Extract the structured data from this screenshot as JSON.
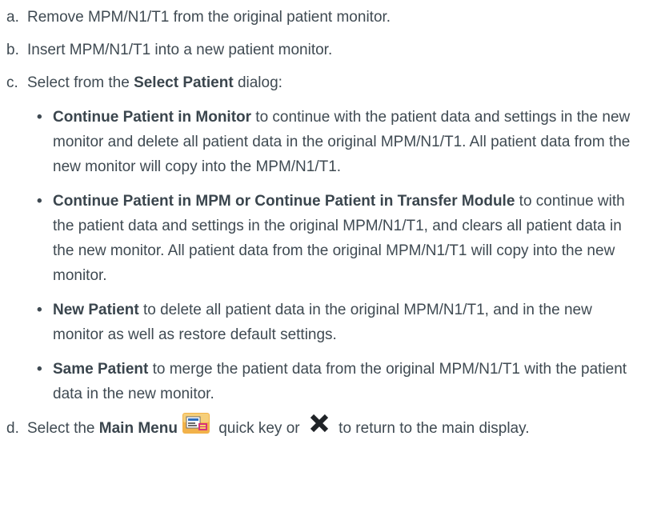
{
  "steps": [
    {
      "letter": "a.",
      "text": "Remove MPM/N1/T1 from the original patient monitor."
    },
    {
      "letter": "b.",
      "text": "Insert MPM/N1/T1 into a new patient monitor."
    },
    {
      "letter": "c.",
      "pre": "Select from the ",
      "bold": "Select Patient",
      "post": " dialog:"
    },
    {
      "letter": "d.",
      "pre": "Select the ",
      "bold": "Main Menu",
      "mid": " quick key or ",
      "post": " to return to the main display."
    }
  ],
  "bullets": [
    {
      "bold": "Continue Patient in Monitor",
      "text": " to continue with the patient data and settings in the new monitor and delete all patient data in the original MPM/N1/T1. All patient data from the new monitor will copy into the MPM/N1/T1."
    },
    {
      "bold": "Continue Patient in MPM or Continue Patient in Transfer Module",
      "text": " to continue with the patient data and settings in the original MPM/N1/T1, and clears all patient data in the new monitor. All patient data from the original MPM/N1/T1 will copy into the new monitor."
    },
    {
      "bold": "New Patient",
      "text": " to delete all patient data in the original MPM/N1/T1, and in the new monitor as well as restore default settings."
    },
    {
      "bold": "Same Patient",
      "text": " to merge the patient data from the original MPM/N1/T1 with the patient data in the new monitor."
    }
  ],
  "bullet_glyph": "•",
  "icons": {
    "main_menu": "main-menu-quick-key-icon",
    "close": "close-x-icon"
  }
}
